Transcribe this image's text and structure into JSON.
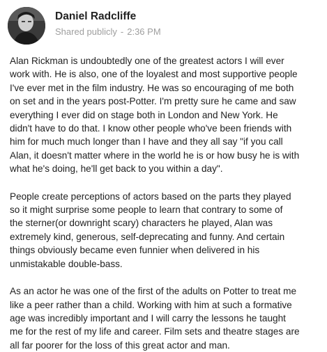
{
  "post": {
    "author": {
      "name": "Daniel Radcliffe",
      "avatar_icon": "profile-photo-icon"
    },
    "meta": {
      "visibility": "Shared publicly",
      "separator": "-",
      "time": "2:36 PM"
    },
    "paragraphs": [
      "Alan Rickman is undoubtedly one of the greatest actors I will ever\nwork with. He is also, one of the loyalest and most supportive people\nI've ever met in the film industry. He was so encouraging of me both\non set and in the years post-Potter. I'm pretty sure he came and saw\neverything I ever did on stage both in London and New York. He\ndidn't have to do that. I know other people who've been friends with\nhim for much much longer than I have and they all say \"if you call\nAlan, it doesn't matter where in the world he is or how busy he is with\nwhat he's doing, he'll get back to you within a day\".",
      "People create perceptions of actors based on the parts they played\nso it might surprise some people to learn that contrary to some of\nthe sterner(or downright scary) characters he played, Alan was\nextremely kind, generous, self-deprecating and funny. And certain\nthings obviously became even funnier when delivered in his\nunmistakable double-bass.",
      "As an actor he was one of the first of the adults on Potter to treat me\nlike a peer rather than a child. Working with him at such a formative\nage was incredibly important and I will carry the lessons he taught\nme for the rest of my life and career. Film sets and theatre stages are\nall far poorer for the loss of this great actor and man."
    ]
  }
}
